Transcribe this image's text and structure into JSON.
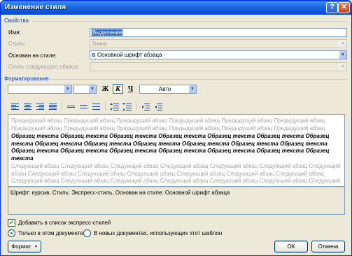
{
  "window": {
    "title": "Изменение стиля",
    "help_glyph": "?",
    "close_glyph": "✕"
  },
  "properties": {
    "heading": "Свойства",
    "name_label": "Имя:",
    "name_value": "Выделение",
    "style_type_label": "Стиль:",
    "style_type_value": "Знака",
    "based_on_label": "Основан на стиле:",
    "based_on_icon": "a",
    "based_on_value": "Основной шрифт абзаца",
    "next_style_label": "Стиль следующего абзаца:",
    "next_style_value": ""
  },
  "formatting": {
    "heading": "Форматирование",
    "font_value": "",
    "size_value": "",
    "bold_label": "Ж",
    "italic_label": "К",
    "underline_label": "Ч",
    "color_value": "Авто",
    "align_buttons": [
      "align-left-icon",
      "align-center-icon",
      "align-right-icon",
      "align-justify-icon"
    ],
    "spacing_buttons": [
      "single-spacing-icon",
      "one-half-spacing-icon",
      "double-spacing-icon"
    ],
    "para_buttons": [
      "space-before-increase-icon",
      "space-before-decrease-icon",
      "indent-decrease-icon",
      "indent-increase-icon"
    ]
  },
  "preview": {
    "previous_paragraph": "Предыдущий абзац Предыдущий абзац Предыдущий абзац Предыдущий абзац Предыдущий абзац Предыдущий абзац Предыдущий абзац Предыдущий абзац Предыдущий абзац Предыдущий абзац Предыдущий абзац Предыдущий абзац",
    "sample_text": "Образец текста Образец текста Образец текста Образец текста Образец текста Образец текста Образец текста Образец текста Образец текста Образец текста Образец текста Образец текста Образец текста Образец текста Образец текста Образец текста Образец текста Образец текста Образец текста Образец текста",
    "next_paragraph": "Следующий абзац Следующий абзац Следующий абзац Следующий абзац Следующий абзац Следующий абзац Следующий абзац Следующий абзац Следующий абзац Следующий абзац Следующий абзац Следующий абзац Следующий абзац Следующий абзац Следующий абзац Следующий абзац Следующий абзац Следующий абзац Следующий абзац Следующий абзац Следующий абзац"
  },
  "description": "Шрифт: курсив, Стиль: Экспресс-стиль, Основан на стиле: Основной шрифт абзаца",
  "options": {
    "add_to_quick_styles": "Добавить в список экспресс-стилей",
    "add_to_quick_styles_checked": true,
    "only_this_document": "Только в этом документе",
    "new_documents": "В новых документах, использующих этот шаблон",
    "selected_scope": "only_this_document"
  },
  "buttons": {
    "format": "Формат",
    "format_arrow": "▼",
    "ok": "ОК",
    "cancel": "Отмена"
  },
  "colors": {
    "accent": "#0046d5",
    "titlebar": "#0a54d6",
    "selection": "#316ac5"
  }
}
